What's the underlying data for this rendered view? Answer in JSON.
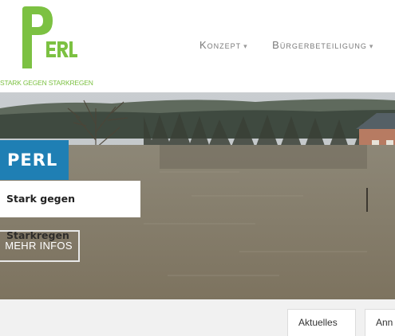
{
  "header": {
    "logo_text": "PERL",
    "logo_tagline": "STARK GEGEN STARKREGEN",
    "nav": [
      {
        "label": "Konzept"
      },
      {
        "label": "Bürgerbeteiligung"
      }
    ]
  },
  "hero": {
    "title": "PERL",
    "subtitle": "Stark gegen Starkregen",
    "button_label": "MEHR INFOS"
  },
  "tabs": [
    {
      "label": "Aktuelles"
    },
    {
      "label": "Ann"
    }
  ],
  "colors": {
    "brand_green": "#7cc142",
    "hero_blue": "#1f7fb4",
    "nav_text": "#7a7a7a",
    "tab_strip_bg": "#f1f1f1"
  },
  "icons": {
    "nav_dropdown": "caret-down-icon"
  }
}
